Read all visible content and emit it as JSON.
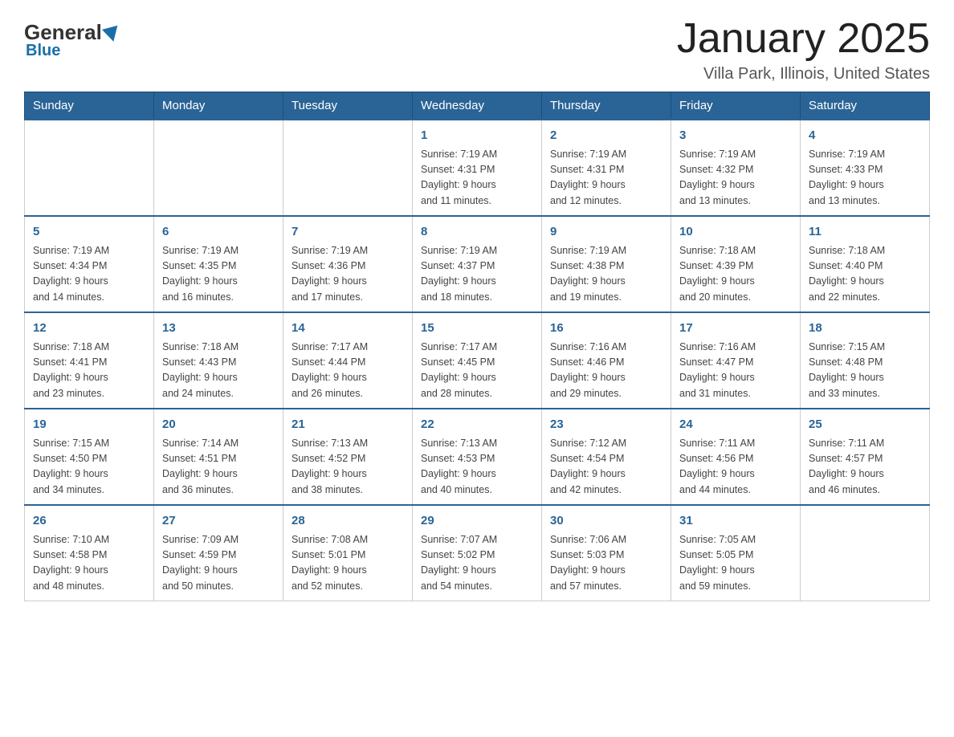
{
  "logo": {
    "general": "General",
    "blue": "Blue",
    "subtitle": "Blue"
  },
  "title": "January 2025",
  "location": "Villa Park, Illinois, United States",
  "days_of_week": [
    "Sunday",
    "Monday",
    "Tuesday",
    "Wednesday",
    "Thursday",
    "Friday",
    "Saturday"
  ],
  "weeks": [
    [
      {
        "day": "",
        "info": ""
      },
      {
        "day": "",
        "info": ""
      },
      {
        "day": "",
        "info": ""
      },
      {
        "day": "1",
        "info": "Sunrise: 7:19 AM\nSunset: 4:31 PM\nDaylight: 9 hours\nand 11 minutes."
      },
      {
        "day": "2",
        "info": "Sunrise: 7:19 AM\nSunset: 4:31 PM\nDaylight: 9 hours\nand 12 minutes."
      },
      {
        "day": "3",
        "info": "Sunrise: 7:19 AM\nSunset: 4:32 PM\nDaylight: 9 hours\nand 13 minutes."
      },
      {
        "day": "4",
        "info": "Sunrise: 7:19 AM\nSunset: 4:33 PM\nDaylight: 9 hours\nand 13 minutes."
      }
    ],
    [
      {
        "day": "5",
        "info": "Sunrise: 7:19 AM\nSunset: 4:34 PM\nDaylight: 9 hours\nand 14 minutes."
      },
      {
        "day": "6",
        "info": "Sunrise: 7:19 AM\nSunset: 4:35 PM\nDaylight: 9 hours\nand 16 minutes."
      },
      {
        "day": "7",
        "info": "Sunrise: 7:19 AM\nSunset: 4:36 PM\nDaylight: 9 hours\nand 17 minutes."
      },
      {
        "day": "8",
        "info": "Sunrise: 7:19 AM\nSunset: 4:37 PM\nDaylight: 9 hours\nand 18 minutes."
      },
      {
        "day": "9",
        "info": "Sunrise: 7:19 AM\nSunset: 4:38 PM\nDaylight: 9 hours\nand 19 minutes."
      },
      {
        "day": "10",
        "info": "Sunrise: 7:18 AM\nSunset: 4:39 PM\nDaylight: 9 hours\nand 20 minutes."
      },
      {
        "day": "11",
        "info": "Sunrise: 7:18 AM\nSunset: 4:40 PM\nDaylight: 9 hours\nand 22 minutes."
      }
    ],
    [
      {
        "day": "12",
        "info": "Sunrise: 7:18 AM\nSunset: 4:41 PM\nDaylight: 9 hours\nand 23 minutes."
      },
      {
        "day": "13",
        "info": "Sunrise: 7:18 AM\nSunset: 4:43 PM\nDaylight: 9 hours\nand 24 minutes."
      },
      {
        "day": "14",
        "info": "Sunrise: 7:17 AM\nSunset: 4:44 PM\nDaylight: 9 hours\nand 26 minutes."
      },
      {
        "day": "15",
        "info": "Sunrise: 7:17 AM\nSunset: 4:45 PM\nDaylight: 9 hours\nand 28 minutes."
      },
      {
        "day": "16",
        "info": "Sunrise: 7:16 AM\nSunset: 4:46 PM\nDaylight: 9 hours\nand 29 minutes."
      },
      {
        "day": "17",
        "info": "Sunrise: 7:16 AM\nSunset: 4:47 PM\nDaylight: 9 hours\nand 31 minutes."
      },
      {
        "day": "18",
        "info": "Sunrise: 7:15 AM\nSunset: 4:48 PM\nDaylight: 9 hours\nand 33 minutes."
      }
    ],
    [
      {
        "day": "19",
        "info": "Sunrise: 7:15 AM\nSunset: 4:50 PM\nDaylight: 9 hours\nand 34 minutes."
      },
      {
        "day": "20",
        "info": "Sunrise: 7:14 AM\nSunset: 4:51 PM\nDaylight: 9 hours\nand 36 minutes."
      },
      {
        "day": "21",
        "info": "Sunrise: 7:13 AM\nSunset: 4:52 PM\nDaylight: 9 hours\nand 38 minutes."
      },
      {
        "day": "22",
        "info": "Sunrise: 7:13 AM\nSunset: 4:53 PM\nDaylight: 9 hours\nand 40 minutes."
      },
      {
        "day": "23",
        "info": "Sunrise: 7:12 AM\nSunset: 4:54 PM\nDaylight: 9 hours\nand 42 minutes."
      },
      {
        "day": "24",
        "info": "Sunrise: 7:11 AM\nSunset: 4:56 PM\nDaylight: 9 hours\nand 44 minutes."
      },
      {
        "day": "25",
        "info": "Sunrise: 7:11 AM\nSunset: 4:57 PM\nDaylight: 9 hours\nand 46 minutes."
      }
    ],
    [
      {
        "day": "26",
        "info": "Sunrise: 7:10 AM\nSunset: 4:58 PM\nDaylight: 9 hours\nand 48 minutes."
      },
      {
        "day": "27",
        "info": "Sunrise: 7:09 AM\nSunset: 4:59 PM\nDaylight: 9 hours\nand 50 minutes."
      },
      {
        "day": "28",
        "info": "Sunrise: 7:08 AM\nSunset: 5:01 PM\nDaylight: 9 hours\nand 52 minutes."
      },
      {
        "day": "29",
        "info": "Sunrise: 7:07 AM\nSunset: 5:02 PM\nDaylight: 9 hours\nand 54 minutes."
      },
      {
        "day": "30",
        "info": "Sunrise: 7:06 AM\nSunset: 5:03 PM\nDaylight: 9 hours\nand 57 minutes."
      },
      {
        "day": "31",
        "info": "Sunrise: 7:05 AM\nSunset: 5:05 PM\nDaylight: 9 hours\nand 59 minutes."
      },
      {
        "day": "",
        "info": ""
      }
    ]
  ]
}
